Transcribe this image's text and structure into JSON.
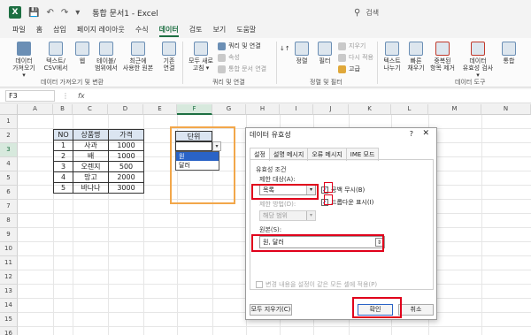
{
  "titlebar": {
    "logo": "X",
    "title": "통합 문서1  -  Excel",
    "search_placeholder": "검색"
  },
  "menu": [
    "파일",
    "홈",
    "삽입",
    "페이지 레이아웃",
    "수식",
    "데이터",
    "검토",
    "보기",
    "도움말"
  ],
  "ribbon": {
    "get_data": "데이터\n가져오기 ▾",
    "text_csv": "텍스트/\nCSV에서",
    "web": "웹",
    "table_range": "테이블/\n범위에서",
    "recent_sources": "최근에\n사용한 원본",
    "existing_conn": "기존\n연결",
    "refresh_all": "모두 새로\n고침 ▾",
    "queries_conn": "쿼리 및 연결",
    "properties": "속성",
    "edit_links": "통합 문서 연결",
    "sort_az": "↓↑",
    "sort": "정렬",
    "filter": "필터",
    "clear": "지우기",
    "reapply": "다시 적용",
    "advanced": "고급",
    "text_to_cols": "텍스트\n나누기",
    "flash_fill": "빠른\n채우기",
    "remove_dup": "중복된\n항목 제거",
    "validation": "데이터\n유효성 검사 ▾",
    "consolidate": "통합",
    "grp_get": "데이터 가져오기 및 변환",
    "grp_queries": "쿼리 및 연결",
    "grp_sort": "정렬 및 필터",
    "grp_tools": "데이터 도구"
  },
  "formula": {
    "namebox": "F3",
    "separator": "⋮",
    "fx": "fx"
  },
  "grid": {
    "columns": [
      "A",
      "B",
      "C",
      "D",
      "E",
      "F",
      "G",
      "H",
      "I",
      "J",
      "K",
      "L",
      "M",
      "N"
    ],
    "rows": [
      "1",
      "2",
      "3",
      "4",
      "5",
      "6",
      "7",
      "8",
      "9",
      "10",
      "11",
      "12",
      "13",
      "14",
      "15",
      "16"
    ]
  },
  "table": {
    "headers": [
      "NO",
      "상품명",
      "가격"
    ],
    "rows": [
      [
        "1",
        "사과",
        "1000"
      ],
      [
        "2",
        "배",
        "1000"
      ],
      [
        "3",
        "오렌지",
        "500"
      ],
      [
        "4",
        "망고",
        "2000"
      ],
      [
        "5",
        "바나나",
        "3000"
      ]
    ]
  },
  "unit": {
    "header": "단위",
    "dropdown_arrow": "▾",
    "options": [
      "원",
      "달러"
    ]
  },
  "dialog": {
    "title": "데이터 유효성",
    "help": "?",
    "close": "✕",
    "tabs": [
      "설정",
      "설명 메시지",
      "오류 메시지",
      "IME 모드"
    ],
    "criteria_label": "유효성 조건",
    "allow_label": "제한 대상(A):",
    "allow_value": "목록",
    "ignore_blank": "공백 무시(B)",
    "in_cell_dropdown": "드롭다운 표시(I)",
    "data_label": "제한 방법(D):",
    "data_value": "해당 범위",
    "source_label": "원본(S):",
    "source_value": "원, 달러",
    "source_btn": "⇕",
    "apply_all": "변경 내용을 설정이 같은 모든 셀에 적용(P)",
    "clear_all": "모두 지우기(C)",
    "ok": "확인",
    "cancel": "취소",
    "check": "✓"
  },
  "colors": {
    "excel_green": "#1d6f42",
    "highlight_red": "#e0001b",
    "unit_orange": "#f2a74a",
    "table_header": "#dbe5f1"
  }
}
